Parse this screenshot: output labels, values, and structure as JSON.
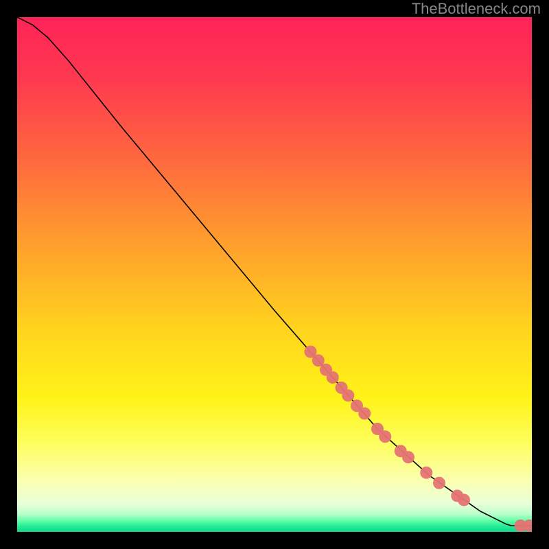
{
  "attribution": "TheBottleneck.com",
  "chart_data": {
    "type": "line",
    "title": "",
    "xlabel": "",
    "ylabel": "",
    "xlim": [
      0,
      100
    ],
    "ylim": [
      0,
      100
    ],
    "curve": [
      {
        "x": 0,
        "y": 100
      },
      {
        "x": 3,
        "y": 98.5
      },
      {
        "x": 6,
        "y": 96
      },
      {
        "x": 10,
        "y": 91.5
      },
      {
        "x": 20,
        "y": 79
      },
      {
        "x": 30,
        "y": 67
      },
      {
        "x": 40,
        "y": 55
      },
      {
        "x": 50,
        "y": 43
      },
      {
        "x": 60,
        "y": 31.5
      },
      {
        "x": 70,
        "y": 20
      },
      {
        "x": 80,
        "y": 11
      },
      {
        "x": 90,
        "y": 4
      },
      {
        "x": 95,
        "y": 1.5
      },
      {
        "x": 96,
        "y": 1.2
      },
      {
        "x": 100,
        "y": 1.2
      }
    ],
    "markers": [
      {
        "x": 57.0,
        "y": 35.0
      },
      {
        "x": 58.5,
        "y": 33.3
      },
      {
        "x": 60.0,
        "y": 31.5
      },
      {
        "x": 61.3,
        "y": 30.0
      },
      {
        "x": 63.0,
        "y": 28.0
      },
      {
        "x": 64.3,
        "y": 26.5
      },
      {
        "x": 66.0,
        "y": 24.5
      },
      {
        "x": 67.5,
        "y": 23.0
      },
      {
        "x": 70.0,
        "y": 20.0
      },
      {
        "x": 71.5,
        "y": 18.5
      },
      {
        "x": 74.5,
        "y": 15.7
      },
      {
        "x": 76.0,
        "y": 14.5
      },
      {
        "x": 79.5,
        "y": 11.5
      },
      {
        "x": 82.0,
        "y": 9.5
      },
      {
        "x": 85.5,
        "y": 7.0
      },
      {
        "x": 86.8,
        "y": 6.2
      },
      {
        "x": 97.8,
        "y": 1.2
      },
      {
        "x": 99.5,
        "y": 1.2
      }
    ],
    "background_gradient": {
      "stops": [
        {
          "offset": 0.0,
          "color": "#ff2358"
        },
        {
          "offset": 0.12,
          "color": "#ff3950"
        },
        {
          "offset": 0.28,
          "color": "#ff6a3e"
        },
        {
          "offset": 0.45,
          "color": "#ffa22c"
        },
        {
          "offset": 0.6,
          "color": "#ffd21e"
        },
        {
          "offset": 0.74,
          "color": "#fff318"
        },
        {
          "offset": 0.83,
          "color": "#feff60"
        },
        {
          "offset": 0.9,
          "color": "#fbffb0"
        },
        {
          "offset": 0.945,
          "color": "#e9ffd8"
        },
        {
          "offset": 0.965,
          "color": "#baffca"
        },
        {
          "offset": 0.978,
          "color": "#66ffab"
        },
        {
          "offset": 0.99,
          "color": "#20e893"
        },
        {
          "offset": 1.0,
          "color": "#16d88a"
        }
      ]
    },
    "marker_style": {
      "radius": 9,
      "fill": "#e57373",
      "opacity": 0.95
    },
    "line_style": {
      "stroke": "#000000",
      "width": 1.6
    }
  }
}
